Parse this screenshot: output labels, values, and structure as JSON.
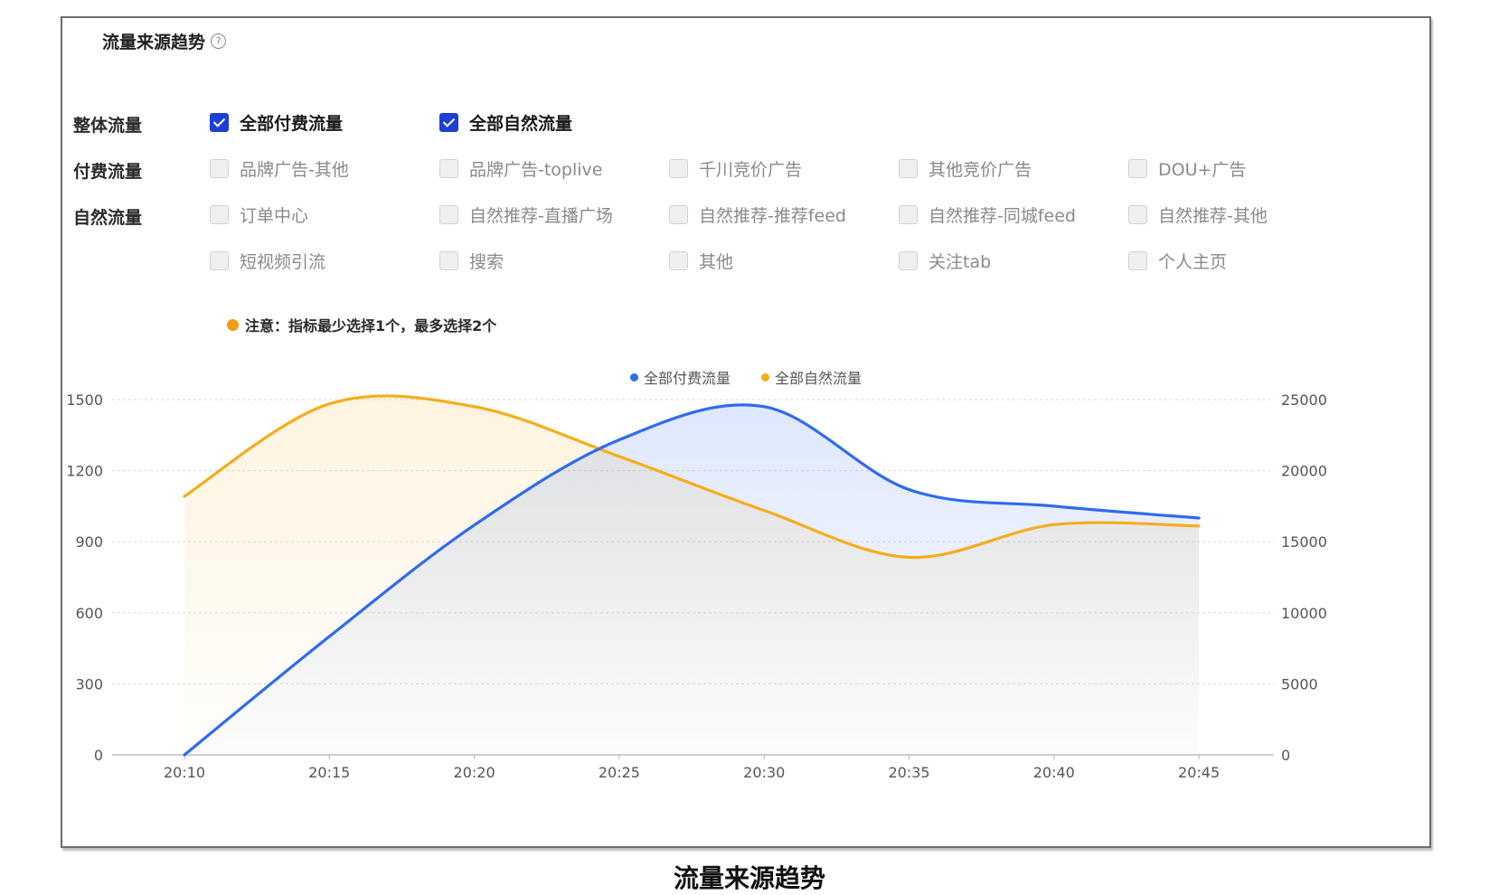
{
  "panel": {
    "title": "流量来源趋势",
    "help_icon_glyph": "?"
  },
  "filters": [
    {
      "label": "整体流量",
      "rows": [
        [
          {
            "label": "全部付费流量",
            "checked": true
          },
          {
            "label": "全部自然流量",
            "checked": true
          }
        ]
      ]
    },
    {
      "label": "付费流量",
      "rows": [
        [
          {
            "label": "品牌广告-其他",
            "checked": false
          },
          {
            "label": "品牌广告-toplive",
            "checked": false
          },
          {
            "label": "千川竞价广告",
            "checked": false
          },
          {
            "label": "其他竞价广告",
            "checked": false
          },
          {
            "label": "DOU+广告",
            "checked": false
          }
        ]
      ]
    },
    {
      "label": "自然流量",
      "rows": [
        [
          {
            "label": "订单中心",
            "checked": false
          },
          {
            "label": "自然推荐-直播广场",
            "checked": false
          },
          {
            "label": "自然推荐-推荐feed",
            "checked": false
          },
          {
            "label": "自然推荐-同城feed",
            "checked": false
          },
          {
            "label": "自然推荐-其他",
            "checked": false
          }
        ],
        [
          {
            "label": "短视频引流",
            "checked": false
          },
          {
            "label": "搜索",
            "checked": false
          },
          {
            "label": "其他",
            "checked": false
          },
          {
            "label": "关注tab",
            "checked": false
          },
          {
            "label": "个人主页",
            "checked": false
          }
        ]
      ]
    }
  ],
  "note": "注意：指标最少选择1个，最多选择2个",
  "colors": {
    "paid": "#2f6bf0",
    "natural": "#f5ad1c",
    "note_dot": "#f59b12",
    "checkbox_on": "#1d3fd6"
  },
  "chart_data": {
    "type": "line",
    "x": [
      "20:10",
      "20:15",
      "20:20",
      "20:25",
      "20:30",
      "20:35",
      "20:40",
      "20:45"
    ],
    "series": [
      {
        "name": "全部付费流量",
        "axis": "left",
        "values": [
          0,
          500,
          970,
          1330,
          1470,
          1120,
          1050,
          1000
        ]
      },
      {
        "name": "全部自然流量",
        "axis": "right",
        "values": [
          18200,
          24700,
          24500,
          21000,
          17200,
          13900,
          16200,
          16100
        ]
      }
    ],
    "y_left": {
      "min": 0,
      "max": 1500,
      "ticks": [
        0,
        300,
        600,
        900,
        1200,
        1500
      ]
    },
    "y_right": {
      "min": 0,
      "max": 25000,
      "ticks": [
        0,
        5000,
        10000,
        15000,
        20000,
        25000
      ]
    },
    "grid": "horizontal-dashed",
    "legend_position": "top-center",
    "smooth": true,
    "area_fill": true
  },
  "caption": "流量来源趋势"
}
